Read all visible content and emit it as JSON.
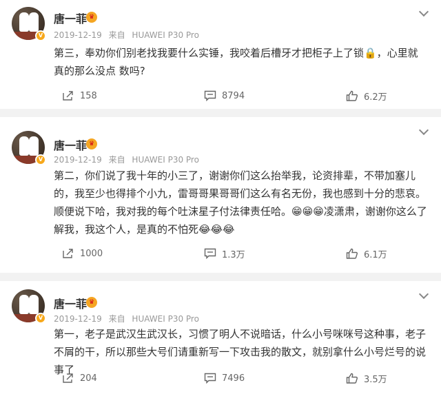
{
  "posts": [
    {
      "user": "唐一菲",
      "date": "2019-12-19",
      "source_prefix": "来自",
      "device": "HUAWEI P30 Pro",
      "text": "第三，奉劝你们别老找我要什么实锤，我咬着后槽牙才把柜子上了锁🔒，心里就真的那么没点 数吗?",
      "reposts": "158",
      "comments": "8794",
      "likes": "6.2万"
    },
    {
      "user": "唐一菲",
      "date": "2019-12-19",
      "source_prefix": "来自",
      "device": "HUAWEI P30 Pro",
      "text": "第二，你们说了我十年的小三了，谢谢你们这么抬举我，论资排辈，不带加塞儿的，我至少也得排个小九，雷哥哥果哥哥们这么有名无份，我也感到十分的悲哀。顺便说下哈，我对我的每个吐沫星子付法律责任哈。😁😁😁凌潇肃，谢谢你这么了解我，我这个人，是真的不怕死😂😂😂",
      "reposts": "1000",
      "comments": "1.3万",
      "likes": "6.1万"
    },
    {
      "user": "唐一菲",
      "date": "2019-12-19",
      "source_prefix": "来自",
      "device": "HUAWEI P30 Pro",
      "text": "第一，老子是武汉生武汉长，习惯了明人不说暗话，什么小号咪咪号这种事，老子不屑的干，所以那些大号们请重新写一下攻击我的散文，就别拿什么小号烂号的说事了",
      "reposts": "204",
      "comments": "7496",
      "likes": "3.5万"
    }
  ],
  "icons": {
    "verified_badge": "v-badge",
    "repost": "share-arrow-icon",
    "comment": "comment-icon",
    "like": "thumbs-up-icon",
    "more": "chevron-down-icon"
  },
  "colors": {
    "username": "#333333",
    "meta": "#999999",
    "badge": "#f7a81b",
    "separator": "#f2f2f2"
  }
}
